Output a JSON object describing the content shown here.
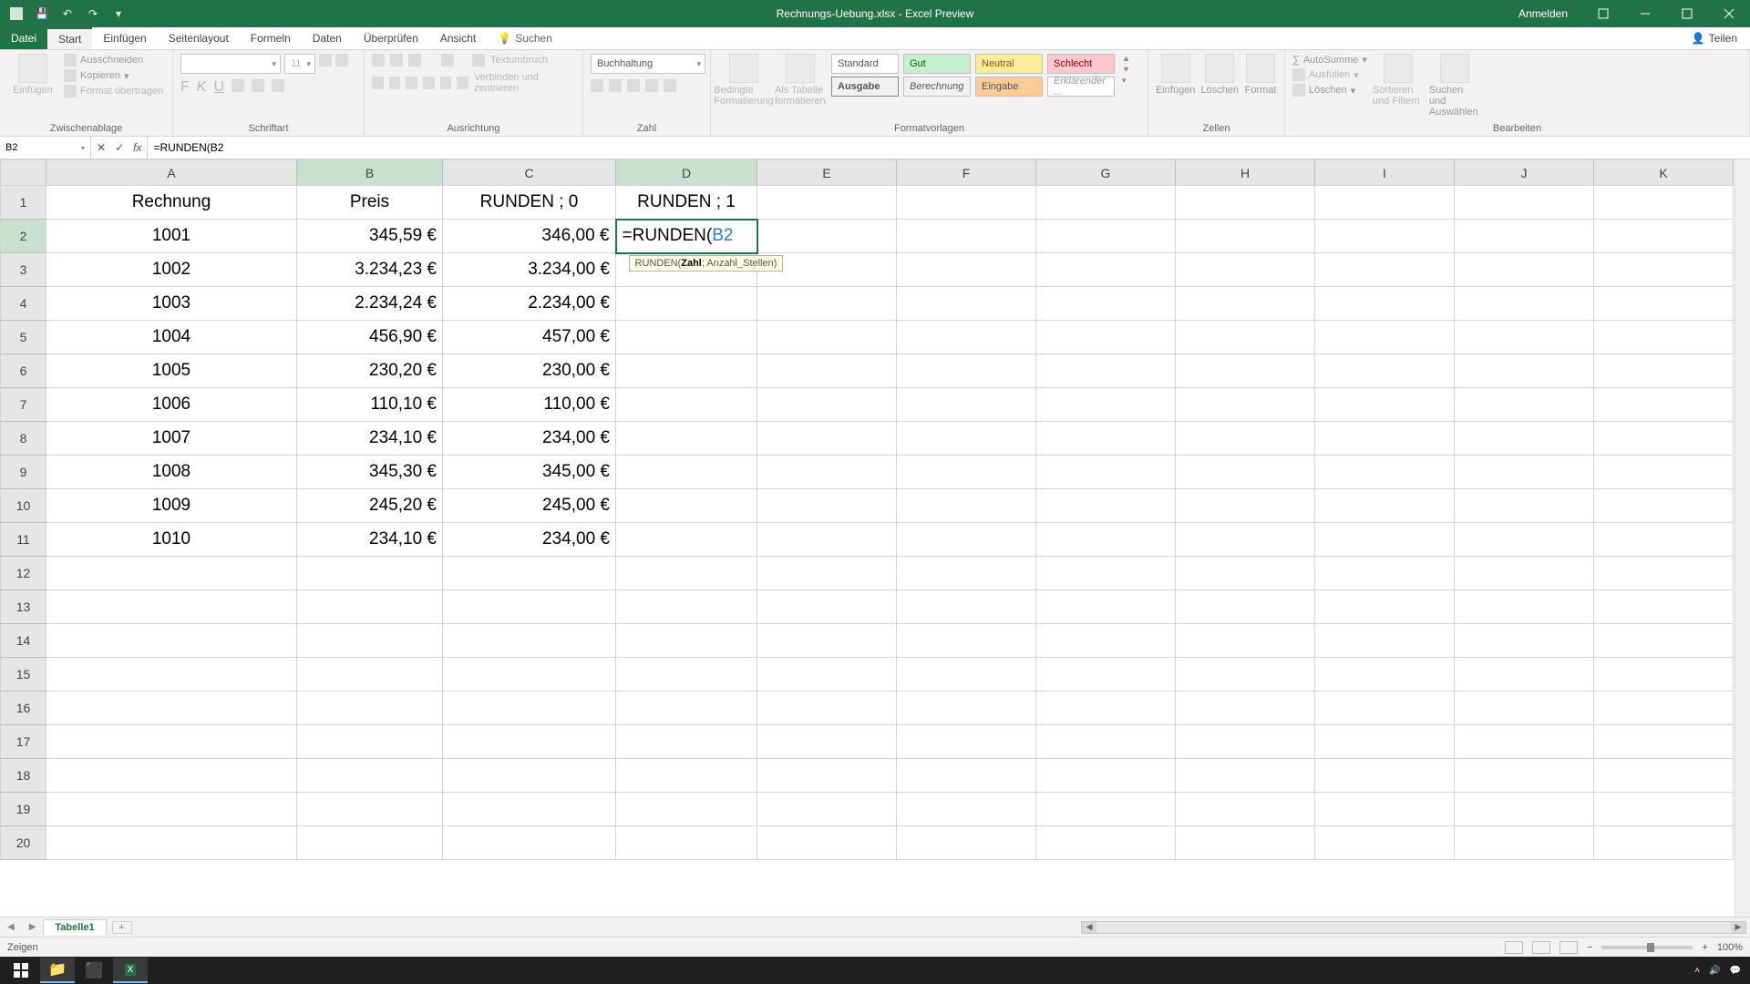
{
  "titlebar": {
    "title": "Rechnungs-Uebung.xlsx - Excel Preview",
    "anmelden": "Anmelden"
  },
  "tabs": {
    "datei": "Datei",
    "start": "Start",
    "einfuegen": "Einfügen",
    "seitenlayout": "Seitenlayout",
    "formeln": "Formeln",
    "daten": "Daten",
    "ueberpruefen": "Überprüfen",
    "ansicht": "Ansicht",
    "suchen": "Suchen",
    "teilen": "Teilen"
  },
  "ribbon": {
    "einfuegen": "Einfügen",
    "ausschneiden": "Ausschneiden",
    "kopieren": "Kopieren",
    "formatuebertragen": "Format übertragen",
    "grp_zwischen": "Zwischenablage",
    "fontsize": "11",
    "grp_schrift": "Schriftart",
    "textumbruch": "Textumbruch",
    "verbinden": "Verbinden und zentrieren",
    "grp_ausrichtung": "Ausrichtung",
    "numformat": "Buchhaltung",
    "grp_zahl": "Zahl",
    "bedingte": "Bedingte Formatierung",
    "alstabelle": "Als Tabelle formatieren",
    "style_standard": "Standard",
    "style_gut": "Gut",
    "style_neutral": "Neutral",
    "style_schlecht": "Schlecht",
    "style_ausgabe": "Ausgabe",
    "style_berechnung": "Berechnung",
    "style_eingabe": "Eingabe",
    "style_erkl": "Erklärender ...",
    "grp_formatvorl": "Formatvorlagen",
    "zellen_einf": "Einfügen",
    "zellen_loe": "Löschen",
    "zellen_fmt": "Format",
    "grp_zellen": "Zellen",
    "autosumme": "AutoSumme",
    "ausfuellen": "Ausfüllen",
    "loeschen": "Löschen",
    "sortieren": "Sortieren und Filtern",
    "suchenausw": "Suchen und Auswählen",
    "grp_bearbeiten": "Bearbeiten"
  },
  "namebox": "B2",
  "formula": "=RUNDEN(B2",
  "columns": [
    "A",
    "B",
    "C",
    "D",
    "E",
    "F",
    "G",
    "H",
    "I",
    "J",
    "K"
  ],
  "headers": {
    "A": "Rechnung",
    "B": "Preis",
    "C": "RUNDEN ; 0",
    "D": "RUNDEN ; 1"
  },
  "rows": [
    {
      "n": 1,
      "A": "Rechnung",
      "B": "Preis",
      "C": "RUNDEN ; 0",
      "D": "RUNDEN ; 1"
    },
    {
      "n": 2,
      "A": "1001",
      "B": "345,59 €",
      "C": "346,00 €",
      "D": "=RUNDEN(B2"
    },
    {
      "n": 3,
      "A": "1002",
      "B": "3.234,23 €",
      "C": "3.234,00 €",
      "D": ""
    },
    {
      "n": 4,
      "A": "1003",
      "B": "2.234,24 €",
      "C": "2.234,00 €",
      "D": ""
    },
    {
      "n": 5,
      "A": "1004",
      "B": "456,90 €",
      "C": "457,00 €",
      "D": ""
    },
    {
      "n": 6,
      "A": "1005",
      "B": "230,20 €",
      "C": "230,00 €",
      "D": ""
    },
    {
      "n": 7,
      "A": "1006",
      "B": "110,10 €",
      "C": "110,00 €",
      "D": ""
    },
    {
      "n": 8,
      "A": "1007",
      "B": "234,10 €",
      "C": "234,00 €",
      "D": ""
    },
    {
      "n": 9,
      "A": "1008",
      "B": "345,30 €",
      "C": "345,00 €",
      "D": ""
    },
    {
      "n": 10,
      "A": "1009",
      "B": "245,20 €",
      "C": "245,00 €",
      "D": ""
    },
    {
      "n": 11,
      "A": "1010",
      "B": "234,10 €",
      "C": "234,00 €",
      "D": ""
    }
  ],
  "tooltip_pre": "RUNDEN(",
  "tooltip_b": "Zahl",
  "tooltip_post": "; Anzahl_Stellen)",
  "sheet": {
    "tab1": "Tabelle1",
    "add": "+"
  },
  "status": {
    "mode": "Zeigen",
    "zoom": "100%"
  }
}
